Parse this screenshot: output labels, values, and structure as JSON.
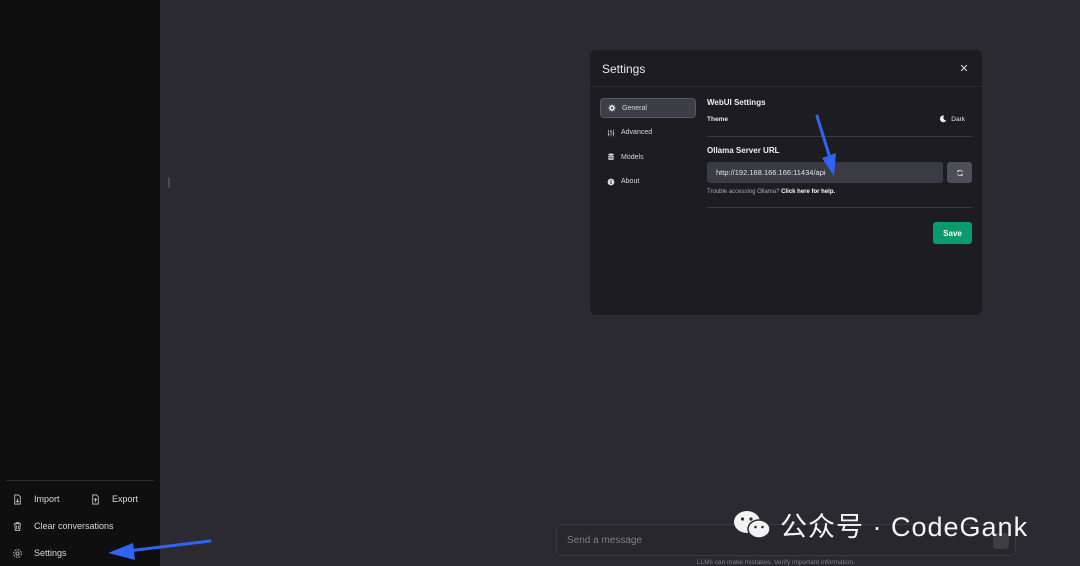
{
  "sidebar": {
    "import_label": "Import",
    "export_label": "Export",
    "clear_label": "Clear conversations",
    "settings_label": "Settings"
  },
  "modal": {
    "title": "Settings",
    "close_glyph": "✕",
    "nav": [
      {
        "label": "General",
        "icon": "gear-icon",
        "active": true
      },
      {
        "label": "Advanced",
        "icon": "sliders-icon",
        "active": false
      },
      {
        "label": "Models",
        "icon": "database-icon",
        "active": false
      },
      {
        "label": "About",
        "icon": "info-icon",
        "active": false
      }
    ],
    "general": {
      "section_title": "WebUI Settings",
      "theme_label": "Theme",
      "theme_value": "Dark",
      "server_url_label": "Ollama Server URL",
      "server_url_value": "http://192.168.166.166:11434/api",
      "help_text": "Trouble accessing Ollama?",
      "help_link": "Click here for help.",
      "save_label": "Save"
    }
  },
  "chat": {
    "placeholder": "Send a message",
    "disclaimer": "LLMs can make mistakes. Verify important information."
  },
  "watermark": {
    "text": "公众号 · CodeGank"
  },
  "colors": {
    "accent_save": "#0b9a6b",
    "annotation_arrow": "#2f63f2"
  }
}
